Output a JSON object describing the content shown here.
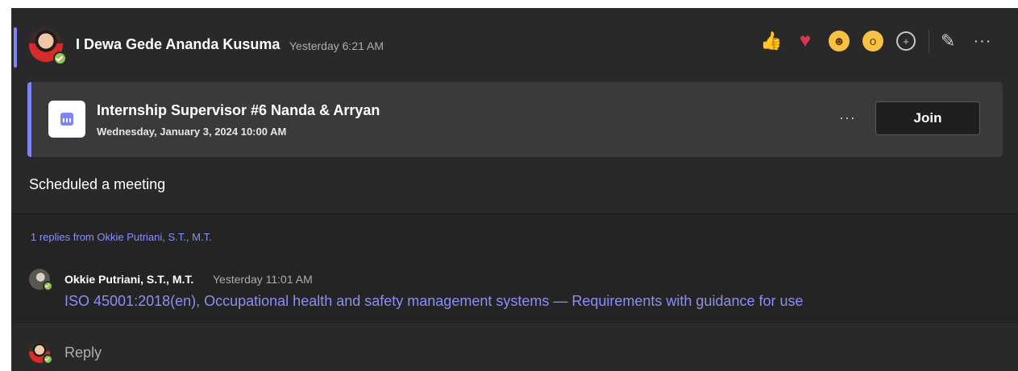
{
  "message": {
    "author": "I Dewa Gede Ananda Kusuma",
    "timestamp": "Yesterday 6:21 AM",
    "body": "Scheduled a meeting"
  },
  "reactions": {
    "like_icon": "thumbs-up-icon",
    "heart_icon": "heart-icon",
    "laugh_icon": "laughing-face-icon",
    "surprised_icon": "surprised-face-icon",
    "add_reaction_icon": "add-reaction-icon",
    "edit_icon": "pencil-icon",
    "more_icon": "more-options-icon"
  },
  "meeting": {
    "title": "Internship Supervisor #6 Nanda & Arryan",
    "datetime": "Wednesday, January 3, 2024 10:00 AM",
    "more_label": "···",
    "join_label": "Join"
  },
  "thread": {
    "summary": "1 replies from Okkie Putriani, S.T., M.T.",
    "reply_author": "Okkie Putriani, S.T., M.T.",
    "reply_time": "Yesterday 11:01 AM",
    "reply_text": "ISO 45001:2018(en), Occupational health and safety management systems — Requirements with guidance for use"
  },
  "composer": {
    "placeholder": "Reply"
  },
  "colors": {
    "background": "#292929",
    "card": "#3a3a3a",
    "accent": "#7f85f5",
    "link": "#8a90f5",
    "presence": "#92c353"
  }
}
